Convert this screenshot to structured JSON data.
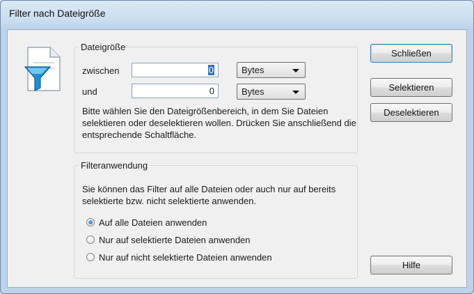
{
  "window": {
    "title": "Filter nach Dateigröße"
  },
  "size_group": {
    "legend": "Dateigröße",
    "between_label": "zwischen",
    "between_value": "0",
    "between_unit": "Bytes",
    "and_label": "und",
    "and_value": "0",
    "and_unit": "Bytes",
    "hint": "Bitte wählen Sie den Dateigrößenbereich, in dem Sie Dateien selektieren oder deselektieren wollen. Drücken Sie anschließend die entsprechende Schaltfläche."
  },
  "apply_group": {
    "legend": "Filteranwendung",
    "hint": "Sie können das Filter auf alle Dateien oder auch nur auf bereits selektierte bzw. nicht selektierte anwenden.",
    "options": [
      {
        "label": "Auf alle Dateien anwenden",
        "checked": true
      },
      {
        "label": "Nur auf selektierte Dateien anwenden",
        "checked": false
      },
      {
        "label": "Nur auf nicht selektierte Dateien anwenden",
        "checked": false
      }
    ]
  },
  "buttons": {
    "close": "Schließen",
    "select": "Selektieren",
    "deselect": "Deselektieren",
    "help": "Hilfe"
  },
  "icons": {
    "dialog_icon": "file-filter-icon",
    "dropdown": "chevron-down-icon"
  }
}
